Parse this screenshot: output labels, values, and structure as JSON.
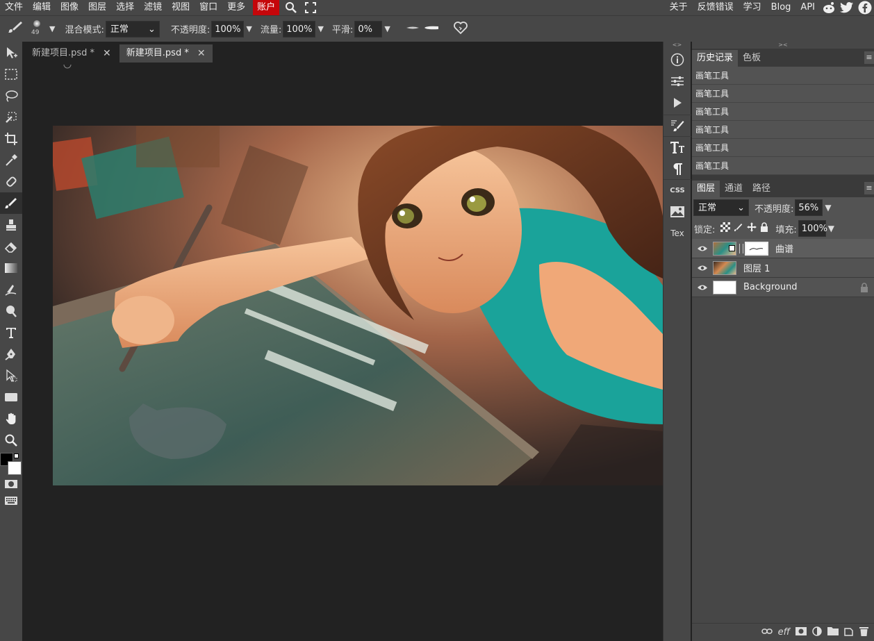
{
  "menubar": {
    "items": [
      "文件",
      "编辑",
      "图像",
      "图层",
      "选择",
      "滤镜",
      "视图",
      "窗口",
      "更多"
    ],
    "account": "账户",
    "right_items": [
      "关于",
      "反馈错误",
      "学习",
      "Blog",
      "API"
    ],
    "icons": [
      "search-icon",
      "fullscreen-icon",
      "reddit-icon",
      "twitter-icon",
      "facebook-icon"
    ]
  },
  "options": {
    "brush_size": "49",
    "blend_label": "混合模式:",
    "blend_value": "正常",
    "opacity_label": "不透明度:",
    "opacity_value": "100%",
    "flow_label": "流量:",
    "flow_value": "100%",
    "smooth_label": "平滑:",
    "smooth_value": "0%"
  },
  "tabs": [
    {
      "label": "新建项目.psd *"
    },
    {
      "label": "新建项目.psd *",
      "active": true
    }
  ],
  "sidepanel": {
    "css_label": "CSS",
    "tex_label": "Tex"
  },
  "history": {
    "tabs": [
      "历史记录",
      "色板"
    ],
    "items": [
      "画笔工具",
      "画笔工具",
      "画笔工具",
      "画笔工具",
      "画笔工具",
      "画笔工具"
    ]
  },
  "layers": {
    "tabs": [
      "图层",
      "通道",
      "路径"
    ],
    "blend_value": "正常",
    "opacity_label": "不透明度:",
    "opacity_value": "56%",
    "lock_label": "锁定:",
    "fill_label": "填充:",
    "fill_value": "100%",
    "items": [
      {
        "name": "曲谱",
        "selected": true
      },
      {
        "name": "图层 1"
      },
      {
        "name": "Background",
        "locked": true
      }
    ],
    "footer_text": "eff"
  },
  "colors": {
    "foreground": "#000000",
    "background": "#ffffff",
    "account_red": "#c5060a"
  }
}
